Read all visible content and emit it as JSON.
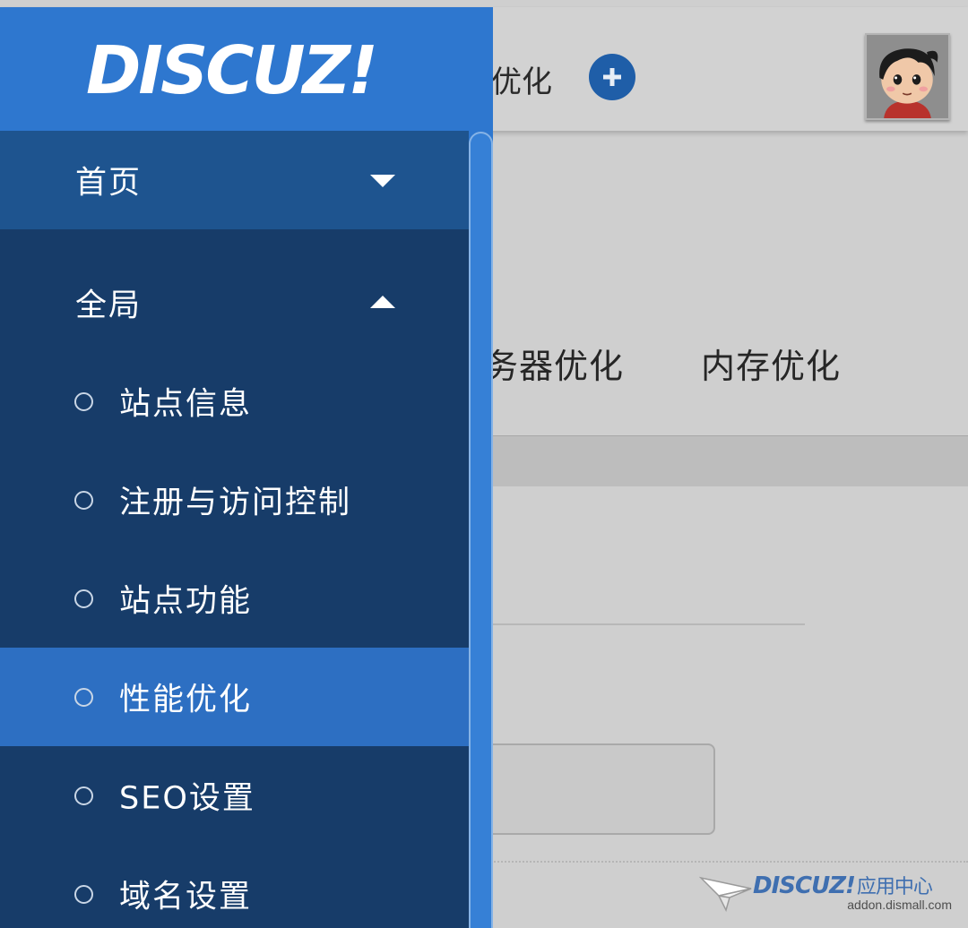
{
  "topbar": {
    "title": "优化",
    "add_icon": "plus-circle-icon"
  },
  "tabs": [
    {
      "label": "务器优化"
    },
    {
      "label": "内存优化"
    }
  ],
  "drawer": {
    "logo": "DISCUZ!",
    "menu": [
      {
        "label": "首页",
        "type": "group",
        "expanded": false
      },
      {
        "label": "全局",
        "type": "group",
        "expanded": true
      },
      {
        "label": "站点信息",
        "type": "sub"
      },
      {
        "label": "注册与访问控制",
        "type": "sub"
      },
      {
        "label": "站点功能",
        "type": "sub"
      },
      {
        "label": "性能优化",
        "type": "sub",
        "active": true
      },
      {
        "label": "SEO设置",
        "type": "sub"
      },
      {
        "label": "域名设置",
        "type": "sub"
      }
    ]
  },
  "watermark": {
    "logo": "DISCUZ!",
    "label": "应用中心",
    "url": "addon.dismall.com"
  },
  "colors": {
    "drawer_blue": "#2e77cf",
    "menu_dark": "#173c69",
    "group_blue": "#1e548f",
    "active_blue": "#2d6fc2",
    "dim_background": "#cfcfcf"
  }
}
